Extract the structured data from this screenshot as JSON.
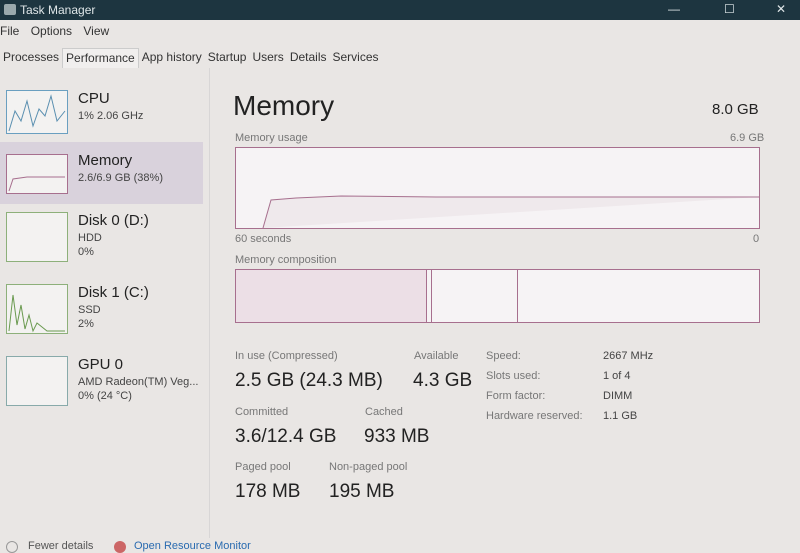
{
  "window": {
    "title": "Task Manager",
    "min": "—",
    "max": "☐",
    "close": "✕"
  },
  "menu": [
    "File",
    "Options",
    "View"
  ],
  "tabs": [
    "Processes",
    "Performance",
    "App history",
    "Startup",
    "Users",
    "Details",
    "Services"
  ],
  "active_tab": "Performance",
  "sidebar": [
    {
      "name": "CPU",
      "line1": "1% 2.06 GHz",
      "line2": ""
    },
    {
      "name": "Memory",
      "line1": "2.6/6.9 GB (38%)",
      "line2": "",
      "selected": true
    },
    {
      "name": "Disk 0 (D:)",
      "line1": "HDD",
      "line2": "0%"
    },
    {
      "name": "Disk 1 (C:)",
      "line1": "SSD",
      "line2": "2%"
    },
    {
      "name": "GPU 0",
      "line1": "AMD Radeon(TM) Veg...",
      "line2": "0% (24 °C)"
    }
  ],
  "main": {
    "title": "Memory",
    "total": "8.0 GB",
    "usage_label": "Memory usage",
    "usage_max": "6.9 GB",
    "axis_left": "60 seconds",
    "axis_right": "0",
    "composition_label": "Memory composition",
    "in_use_label": "In use (Compressed)",
    "in_use": "2.5 GB (24.3 MB)",
    "available_label": "Available",
    "available": "4.3 GB",
    "committed_label": "Committed",
    "committed": "3.6/12.4 GB",
    "cached_label": "Cached",
    "cached": "933 MB",
    "paged_label": "Paged pool",
    "paged": "178 MB",
    "nonpaged_label": "Non-paged pool",
    "nonpaged": "195 MB",
    "specs": [
      {
        "k": "Speed:",
        "v": "2667 MHz"
      },
      {
        "k": "Slots used:",
        "v": "1 of 4"
      },
      {
        "k": "Form factor:",
        "v": "DIMM"
      },
      {
        "k": "Hardware reserved:",
        "v": "1.1 GB"
      }
    ]
  },
  "footer": {
    "fewer": "Fewer details",
    "monitor": "Open Resource Monitor"
  },
  "colors": {
    "accent": "#a76f8e",
    "titlebar": "#1d3540"
  }
}
